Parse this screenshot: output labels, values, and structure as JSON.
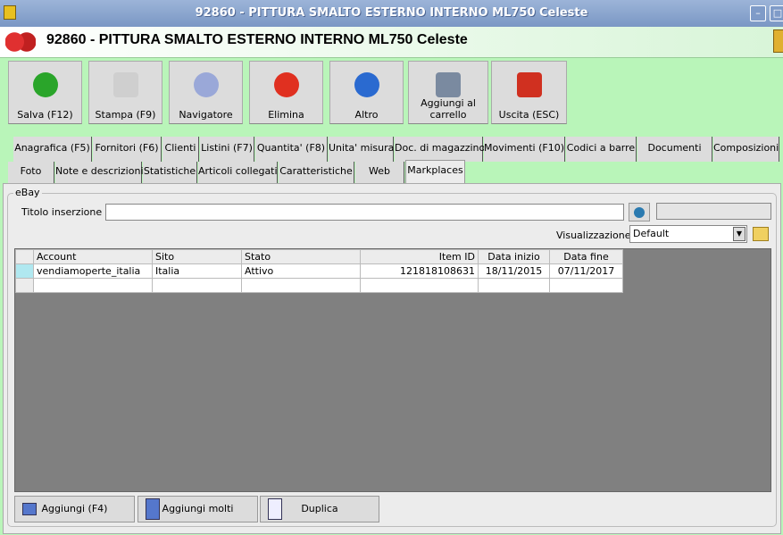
{
  "window": {
    "title": "92860 - PITTURA SMALTO ESTERNO INTERNO ML750 Celeste",
    "minimize": "–",
    "maximize": "□"
  },
  "header": {
    "title": "92860 - PITTURA SMALTO ESTERNO INTERNO ML750 Celeste"
  },
  "toolbar": [
    {
      "label": "Salva (F12)",
      "icon": "check-icon",
      "color": "#2aa52a"
    },
    {
      "label": "Stampa (F9)",
      "icon": "printer-icon",
      "color": "#cfcfcf"
    },
    {
      "label": "Navigatore",
      "icon": "compass-icon",
      "color": "#9aa8d8"
    },
    {
      "label": "Elimina",
      "icon": "x-icon",
      "color": "#e03020"
    },
    {
      "label": "Altro",
      "icon": "magnifier-book-icon",
      "color": "#2a6ad0"
    },
    {
      "label": "Aggiungi al carrello",
      "icon": "cart-icon",
      "color": "#7a8aa0"
    },
    {
      "label": "Uscita (ESC)",
      "icon": "power-icon",
      "color": "#d03020"
    }
  ],
  "tabs_row1": [
    "Anagrafica (F5)",
    "Fornitori (F6)",
    "Clienti",
    "Listini (F7)",
    "Quantita' (F8)",
    "Unita' misura",
    "Doc. di magazzino",
    "Movimenti (F10)",
    "Codici a barre",
    "Documenti",
    "Composizioni"
  ],
  "tabs_row2": [
    "Foto",
    "Note e descrizioni",
    "Statistiche",
    "Articoli collegati",
    "Caratteristiche",
    "Web",
    "Markplaces"
  ],
  "group": {
    "title": "eBay",
    "titolo_label": "Titolo inserzione :",
    "titolo_value": "",
    "visual_label": "Visualizzazione :",
    "visual_value": "Default"
  },
  "table": {
    "columns": [
      "Account",
      "Sito",
      "Stato",
      "Item ID",
      "Data inizio",
      "Data fine"
    ],
    "rows": [
      [
        "vendiamoperte_italia",
        "Italia",
        "Attivo",
        "121818108631",
        "18/11/2015",
        "07/11/2017"
      ]
    ]
  },
  "buttons": {
    "add": "Aggiungi (F4)",
    "add_many": "Aggiungi molti",
    "duplicate": "Duplica"
  }
}
